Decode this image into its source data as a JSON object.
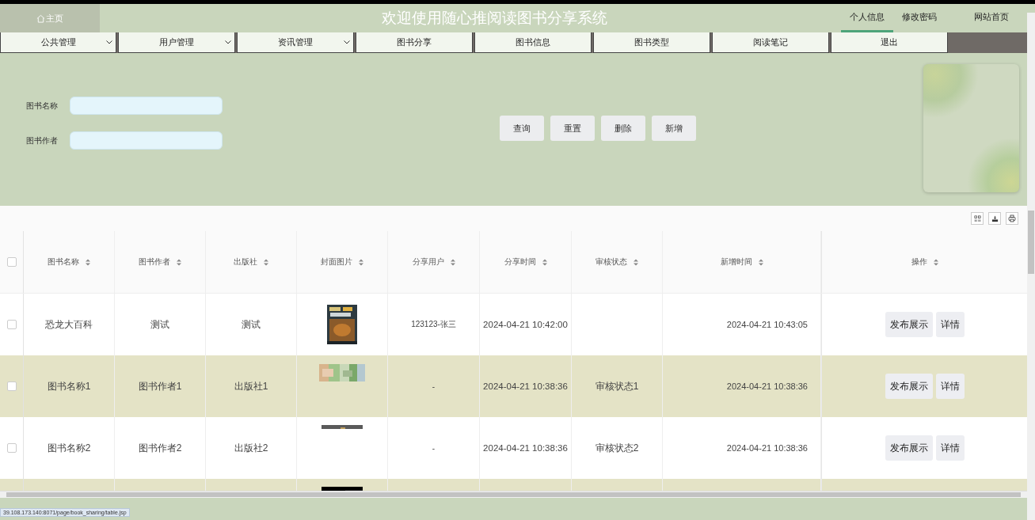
{
  "header": {
    "home": "主页",
    "title": "欢迎使用随心推阅读图书分享系统",
    "links": [
      {
        "label": "个人信息",
        "selected": true
      },
      {
        "label": "修改密码",
        "selected": false
      },
      {
        "label": "网站首页",
        "selected": false
      }
    ]
  },
  "nav": [
    {
      "label": "公共管理",
      "dropdown": true
    },
    {
      "label": "用户管理",
      "dropdown": true
    },
    {
      "label": "资讯管理",
      "dropdown": true
    },
    {
      "label": "图书分享",
      "dropdown": false
    },
    {
      "label": "图书信息",
      "dropdown": false
    },
    {
      "label": "图书类型",
      "dropdown": false
    },
    {
      "label": "阅读笔记",
      "dropdown": false
    },
    {
      "label": "退出",
      "dropdown": false
    }
  ],
  "search": {
    "fields": [
      {
        "label": "图书名称"
      },
      {
        "label": "图书作者"
      }
    ],
    "buttons": [
      "查询",
      "重置",
      "删除",
      "新增"
    ]
  },
  "table": {
    "columns": [
      "图书名称",
      "图书作者",
      "出版社",
      "封面图片",
      "分享用户",
      "分享时间",
      "审核状态",
      "新增时间",
      "操作"
    ],
    "all_checked": false,
    "rows": [
      {
        "checked": false,
        "cells": [
          "恐龙大百科",
          "测试",
          "测试",
          "",
          "123123-张三",
          "2024-04-21 10:42:00",
          "",
          "2024-04-21 10:43:05"
        ],
        "actions": [
          "发布展示",
          "详情"
        ]
      },
      {
        "checked": false,
        "cells": [
          "图书名称1",
          "图书作者1",
          "出版社1",
          "",
          "-",
          "2024-04-21 10:38:36",
          "审核状态1",
          "2024-04-21 10:38:36"
        ],
        "actions": [
          "发布展示",
          "详情"
        ]
      },
      {
        "checked": false,
        "cells": [
          "图书名称2",
          "图书作者2",
          "出版社2",
          "",
          "-",
          "2024-04-21 10:38:36",
          "审核状态2",
          "2024-04-21 10:38:36"
        ],
        "actions": [
          "发布展示",
          "详情"
        ]
      }
    ]
  },
  "status_bar": "39.108.173.140:8071/page/book_sharing/table.jsp"
}
